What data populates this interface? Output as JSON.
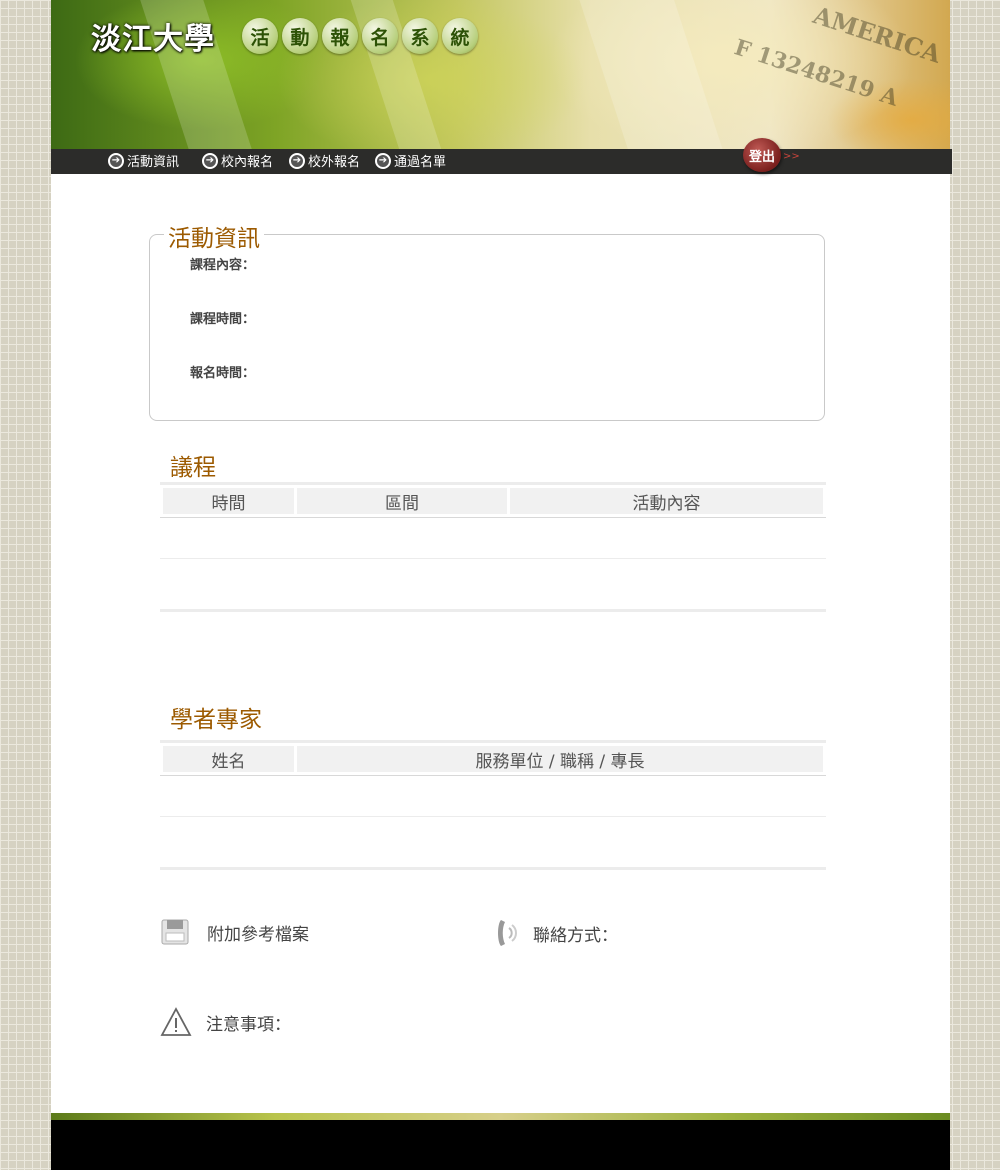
{
  "header": {
    "university": "淡江大學",
    "system_title_chars": [
      "活",
      "動",
      "報",
      "名",
      "系",
      "統"
    ],
    "banner_text_1": "F 13248219 A",
    "banner_text_2": "AMERICA"
  },
  "nav": {
    "items": [
      {
        "label": "活動資訊",
        "icon": "arrow-circle-icon"
      },
      {
        "label": "校內報名",
        "icon": "arrow-circle-icon"
      },
      {
        "label": "校外報名",
        "icon": "arrow-circle-icon"
      },
      {
        "label": "通過名單",
        "icon": "arrow-circle-icon"
      }
    ],
    "logout_label": "登出",
    "logout_chevron": ">>"
  },
  "activity_info": {
    "title": "活動資訊",
    "course_content_label": "課程內容：",
    "course_time_label": "課程時間：",
    "registration_time_label": "報名時間："
  },
  "agenda": {
    "title": "議程",
    "columns": [
      "時間",
      "區間",
      "活動內容"
    ]
  },
  "experts": {
    "title": "學者專家",
    "columns": [
      "姓名",
      "服務單位 / 職稱 / 專長"
    ]
  },
  "footer": {
    "attachment_label": "附加參考檔案",
    "contact_label": "聯絡方式：",
    "notes_label": "注意事項："
  },
  "colors": {
    "section_title": "#9c5a00",
    "navbar": "#2c2c2a",
    "logout": "#8b2a27"
  }
}
